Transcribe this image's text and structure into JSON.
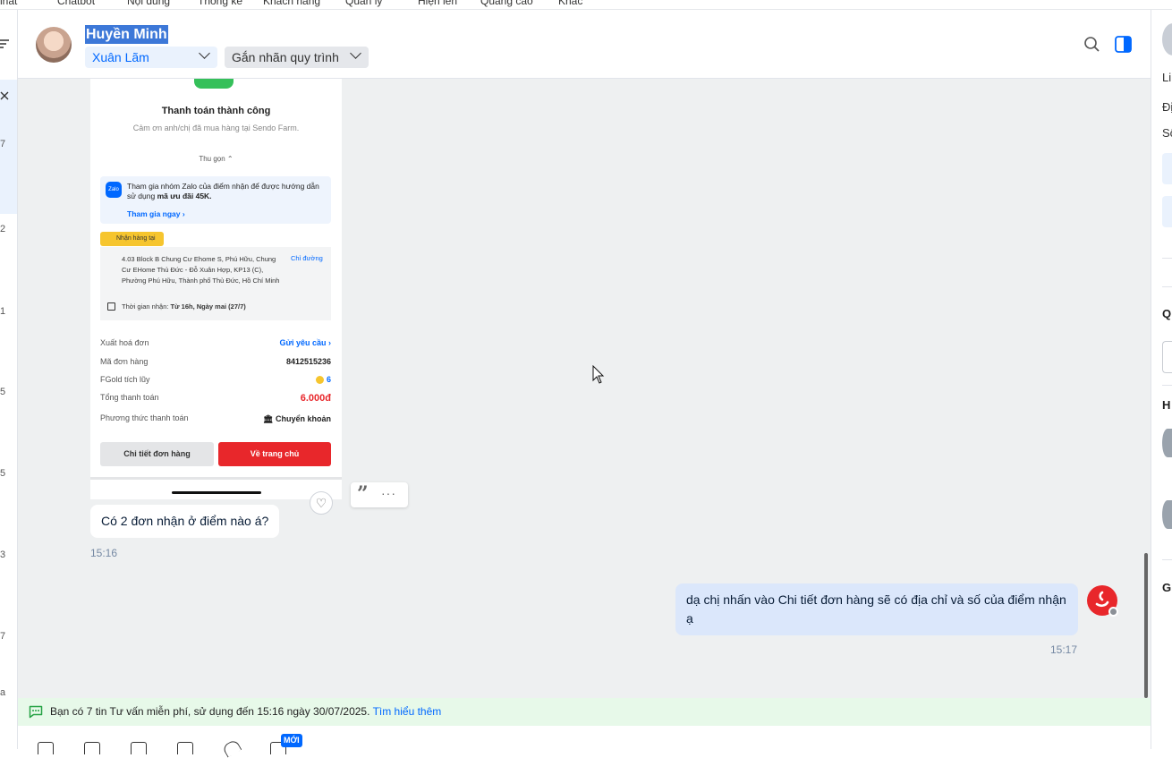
{
  "topnav": [
    "nhất",
    "Chatbot",
    "Nội dung",
    "Thống kê",
    "Khách hàng",
    "Quản lý",
    "Hiện lên",
    "Quảng cáo",
    "Khác"
  ],
  "left_numbers": [
    "7",
    "2",
    "1",
    "5",
    "5",
    "3",
    "7",
    "a"
  ],
  "header": {
    "contact_name": "Huyền Minh",
    "assignee": "Xuân Lãm",
    "label_dropdown": "Gắn nhãn quy trình"
  },
  "receipt": {
    "title": "Thanh toán thành công",
    "subtitle": "Cảm ơn anh/chị đã mua hàng tại Sendo Farm.",
    "collapse": "Thu gọn",
    "zalo_text": "Tham gia nhóm Zalo của điểm nhận để được hướng dẫn sử dụng",
    "zalo_bold": "mã ưu đãi 45K.",
    "zalo_join": "Tham gia ngay",
    "pickup_badge": "Nhận hàng tại",
    "address": "4.03 Block B Chung Cư Ehome S, Phú Hữu, Chung Cư EHome Thủ Đức - Đỗ Xuân Hợp, KP13 (C), Phường Phú Hữu, Thành phố Thủ Đức, Hồ Chí Minh",
    "directions": "Chỉ đường",
    "time_label": "Thời gian nhận:",
    "time_value": "Từ 16h, Ngày mai (27/7)",
    "rows": [
      {
        "label": "Xuất hoá đơn",
        "value": "Gửi yêu cầu"
      },
      {
        "label": "Mã đơn hàng",
        "value": "8412515236"
      },
      {
        "label": "FGold tích lũy",
        "value": "6"
      },
      {
        "label": "Tổng thanh toán",
        "value": "6.000đ"
      },
      {
        "label": "Phương thức thanh toán",
        "value": "Chuyển khoản"
      }
    ],
    "btn_detail": "Chi tiết đơn hàng",
    "btn_home": "Về trang chủ"
  },
  "messages": {
    "incoming_text": "Có 2 đơn nhận ở điểm nào á?",
    "incoming_time": "15:16",
    "outgoing_text": "dạ chị nhấn vào Chi tiết đơn hàng sẽ có địa chỉ và số của điểm nhận ạ",
    "outgoing_time": "15:17"
  },
  "notice": {
    "text": "Bạn có 7 tin Tư vấn miễn phí, sử dụng đến 15:16 ngày 30/07/2025.",
    "link": "Tìm hiểu thêm"
  },
  "toolbar": {
    "new_badge": "MỚI"
  },
  "right_panel_letters": [
    "Li",
    "Đị",
    "Số",
    "Q",
    "H",
    "Gl"
  ],
  "colors": {
    "accent": "#0068ff",
    "red": "#e8272b",
    "bubble_out": "#dbe7fb",
    "chat_bg": "#eef0f1"
  }
}
